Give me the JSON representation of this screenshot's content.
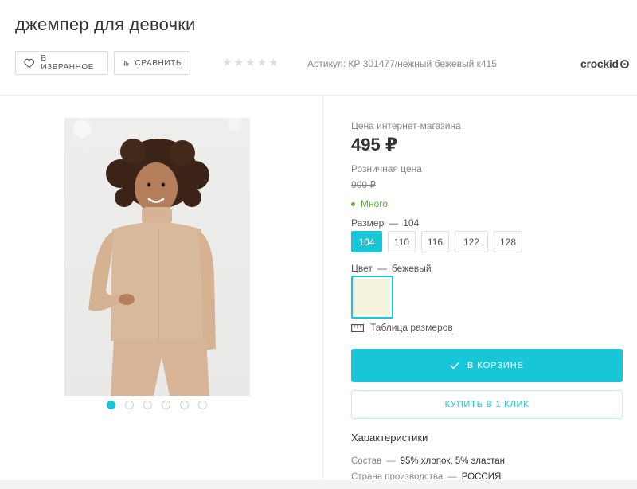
{
  "product": {
    "title": "джемпер для девочки",
    "sku": "Артикул: КР 301477/нежный бежевый к415",
    "rating_stars": 0,
    "rating_max": 5
  },
  "actions": {
    "favorite_label": "В ИЗБРАННОЕ",
    "compare_label": "СРАВНИТЬ"
  },
  "brand": {
    "name": "crockid"
  },
  "gallery": {
    "image_count": 6,
    "active_index": 0
  },
  "pricing": {
    "online_label": "Цена интернет-магазина",
    "online_price": "495 ₽",
    "retail_label": "Розничная цена",
    "retail_price": "900 ₽",
    "stock": "Много"
  },
  "size": {
    "label": "Размер",
    "dash": "—",
    "selected": "104",
    "options": [
      "104",
      "110",
      "116",
      "122",
      "128"
    ]
  },
  "color": {
    "label": "Цвет",
    "dash": "—",
    "selected": "бежевый",
    "swatch_hex": "#f4f4dc"
  },
  "size_table_label": "Таблица размеров",
  "cart_label": "В КОРЗИНЕ",
  "one_click_label": "КУПИТЬ В 1 КЛИК",
  "characteristics": {
    "title": "Характеристики",
    "rows": [
      {
        "key": "Состав",
        "dash": "—",
        "value": "95% хлопок, 5% эластан"
      },
      {
        "key": "Страна производства",
        "dash": "—",
        "value": "РОССИЯ"
      }
    ]
  },
  "colors": {
    "accent": "#19c6d8",
    "stock_green": "#5fae3f"
  }
}
